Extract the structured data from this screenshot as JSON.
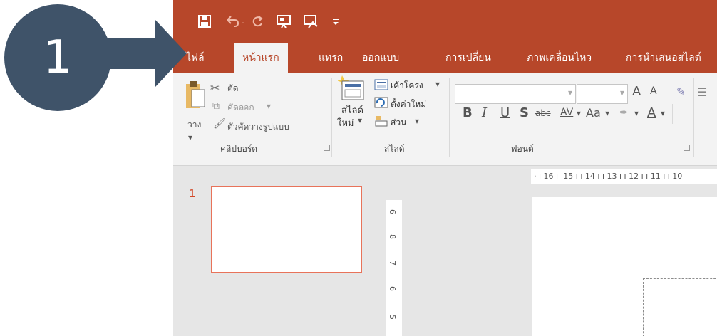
{
  "tabs": [
    "ไฟล์",
    "หน้าแรก",
    "แทรก",
    "ออกแบบ",
    "การเปลี่ยน",
    "ภาพเคลื่อนไหว",
    "การนำเสนอสไลด์"
  ],
  "ribbon": {
    "clipboard": {
      "paste": "วาง",
      "cut": "ตัด",
      "copy": "คัดลอก",
      "format_painter": "ตัวคัดวางรูปแบบ",
      "group": "คลิปบอร์ด"
    },
    "slides": {
      "new_slide_line1": "สไลด์",
      "new_slide_line2": "ใหม่",
      "layout": "เค้าโครง",
      "reset": "ตั้งค่าใหม่",
      "section": "ส่วน",
      "group": "สไลด์"
    },
    "font": {
      "group": "ฟอนต์",
      "bold": "B",
      "italic": "I",
      "underline": "U",
      "shadow": "S",
      "strike": "abc",
      "spacing": "AV",
      "case": "Aa",
      "grow": "A",
      "shrink": "A",
      "color": "A"
    }
  },
  "thumbnails": {
    "slide_number": "1"
  },
  "ruler": {
    "h_ticks": "· ı 16 ı ¦15 ı ı 14 ı ı 13 ı ı 12 ı ı 11 ı ı 10",
    "v_ticks": [
      "6",
      "8",
      "7",
      "6",
      "5"
    ]
  },
  "callout": {
    "number": "1"
  },
  "colors": {
    "accent": "#b7472a",
    "callout": "#3f5369",
    "selection": "#e8735a"
  },
  "icons": [
    "save-icon",
    "undo-icon",
    "redo-icon",
    "present-from-start-icon",
    "touch-mode-icon",
    "customize-qat-icon",
    "paste-icon",
    "cut-icon",
    "copy-icon",
    "format-painter-icon",
    "new-slide-icon",
    "layout-icon",
    "reset-icon",
    "section-icon"
  ]
}
